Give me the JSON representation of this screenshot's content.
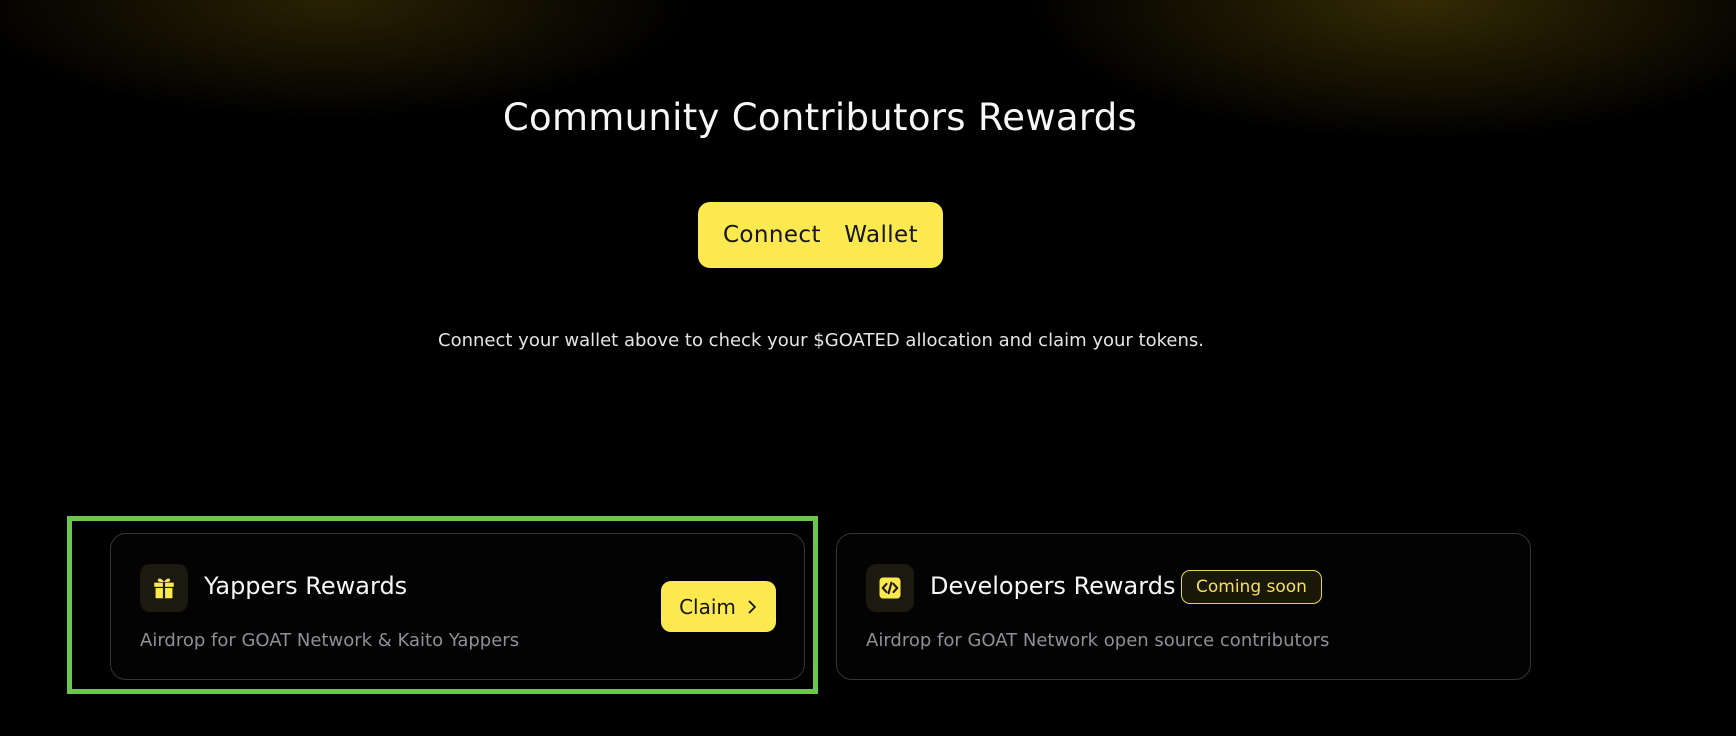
{
  "header": {
    "title": "Community Contributors Rewards",
    "connect_label": "Connect  Wallet",
    "hint": "Connect your wallet above to check your $GOATED allocation and claim your tokens."
  },
  "cards": [
    {
      "icon": "gift-icon",
      "title": "Yappers Rewards",
      "description": "Airdrop for GOAT Network & Kaito Yappers",
      "action_label": "Claim",
      "highlighted": true
    },
    {
      "icon": "code-icon",
      "title": "Developers Rewards",
      "description": "Airdrop for GOAT Network open source contributors",
      "badge": "Coming soon"
    }
  ],
  "colors": {
    "accent": "#fce94f",
    "background": "#000000",
    "highlight": "#6ac64c",
    "card_border": "#34343a",
    "muted_text": "#8f8f96"
  }
}
